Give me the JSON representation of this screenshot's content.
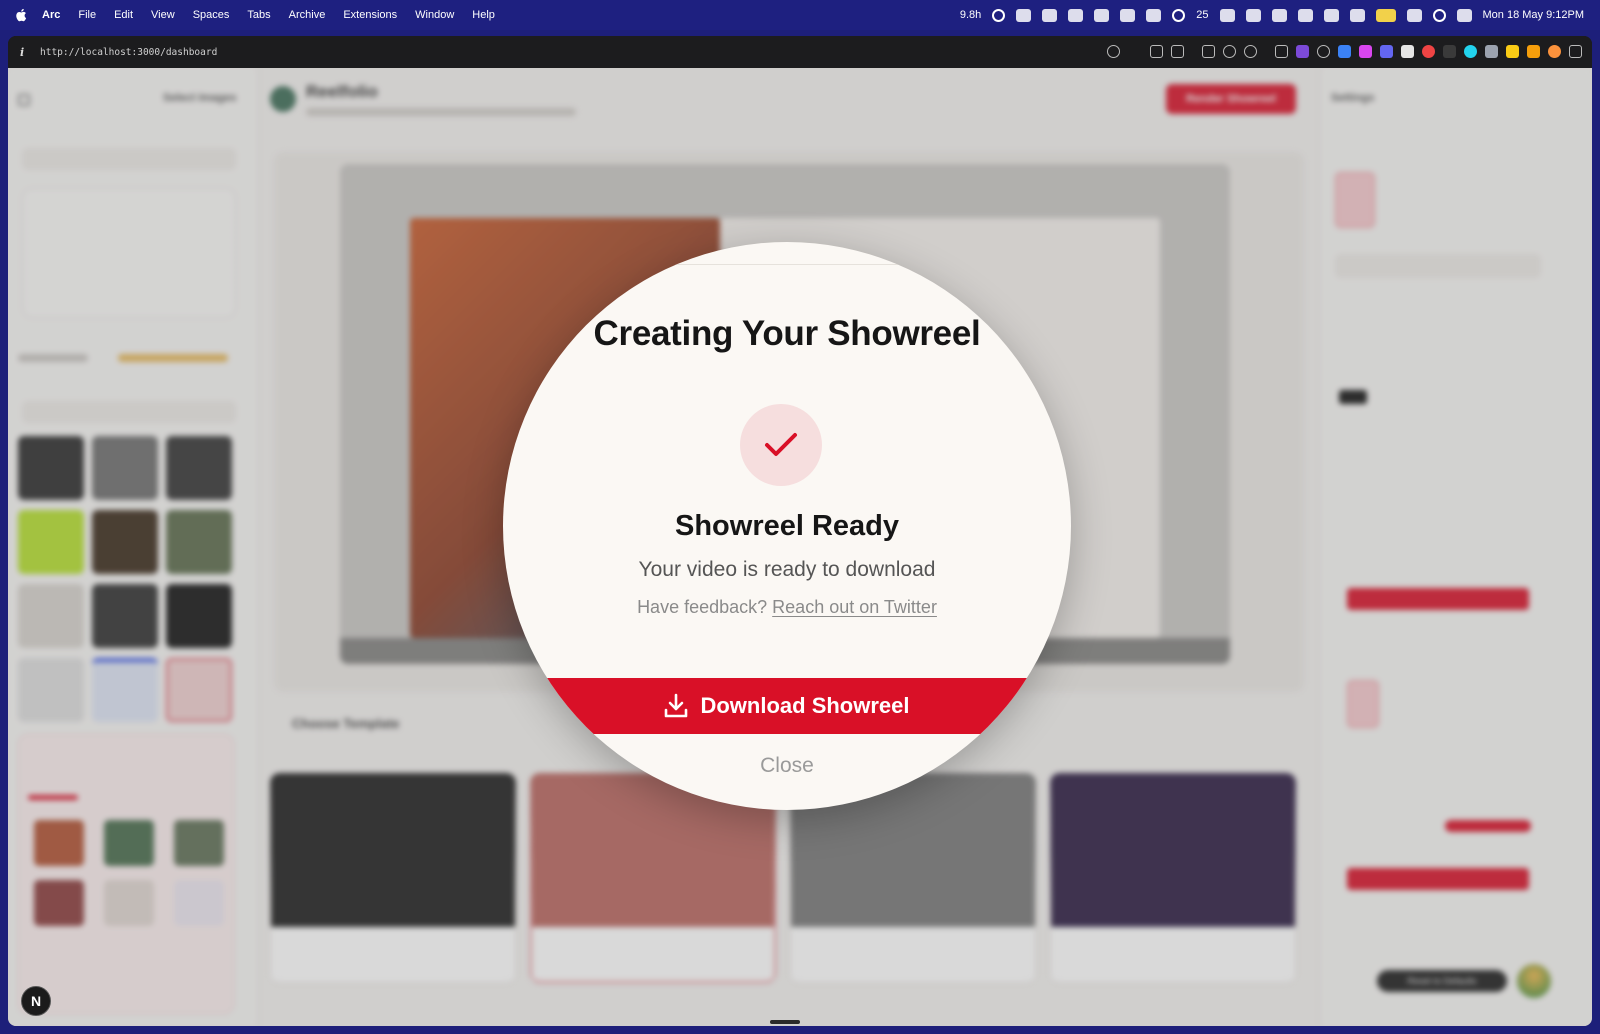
{
  "menubar": {
    "app": "Arc",
    "items": [
      "File",
      "Edit",
      "View",
      "Spaces",
      "Tabs",
      "Archive",
      "Extensions",
      "Window",
      "Help"
    ],
    "tray_timer": "9.8h",
    "tray_count": "25",
    "datetime": "Mon 18 May  9:12PM"
  },
  "browser": {
    "url": "http://localhost:3000/dashboard"
  },
  "modal": {
    "title": "Creating Your Showreel",
    "status_title": "Showreel Ready",
    "status_subtitle": "Your video is ready to download",
    "feedback_prefix": "Have feedback?",
    "feedback_link": "Reach out on Twitter",
    "download_label": "Download Showreel",
    "close_label": "Close",
    "accent": "#d91027"
  },
  "background_app": {
    "name": "Reelfolio",
    "header_button": "Render Showreel",
    "left_sidebar_title": "Select Images",
    "right_sidebar_title": "Settings",
    "section_title": "Choose Template",
    "reset_label": "Reset to Defaults"
  },
  "user_badge": "N"
}
